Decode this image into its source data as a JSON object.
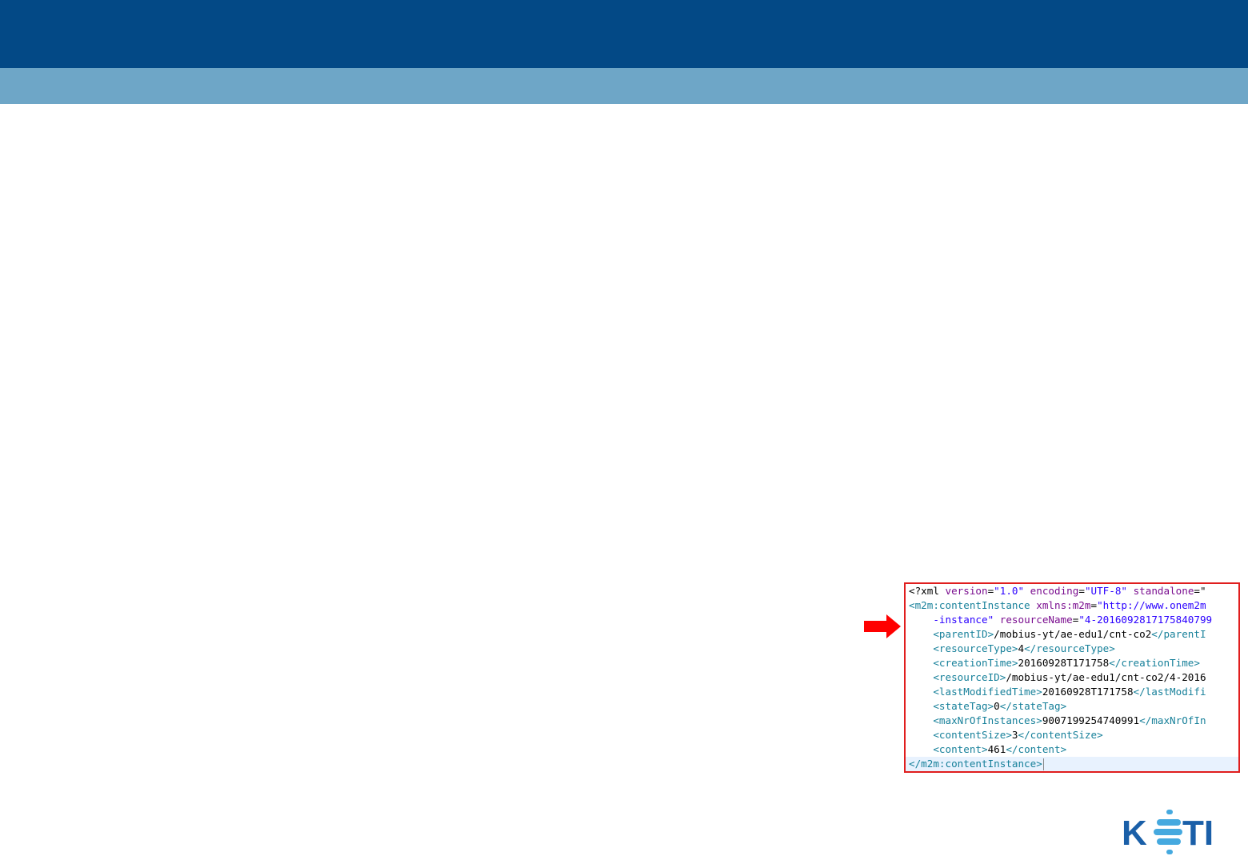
{
  "colors": {
    "header_dark": "#034986",
    "header_light": "#6ea6c7",
    "highlight_border": "#e01e1e",
    "arrow": "#ff0000",
    "logo_blue": "#1a5fa8",
    "logo_dots": "#45a9df"
  },
  "arrow_icon": "red-right-arrow",
  "xml": {
    "lines": [
      {
        "parts": [
          {
            "c": "c-txt",
            "t": "<?xml "
          },
          {
            "c": "c-attr",
            "t": "version"
          },
          {
            "c": "c-txt",
            "t": "="
          },
          {
            "c": "c-str",
            "t": "\"1.0\""
          },
          {
            "c": "c-attr",
            "t": " encoding"
          },
          {
            "c": "c-txt",
            "t": "="
          },
          {
            "c": "c-str",
            "t": "\"UTF-8\""
          },
          {
            "c": "c-attr",
            "t": " standalone"
          },
          {
            "c": "c-txt",
            "t": "=\""
          }
        ]
      },
      {
        "parts": [
          {
            "c": "c-tag",
            "t": "<m2m:contentInstance "
          },
          {
            "c": "c-attr",
            "t": "xmlns:m2m"
          },
          {
            "c": "c-txt",
            "t": "="
          },
          {
            "c": "c-str",
            "t": "\"http://www.onem2m"
          }
        ]
      },
      {
        "parts": [
          {
            "c": "c-str",
            "t": "    -instance\""
          },
          {
            "c": "c-attr",
            "t": " resourceName"
          },
          {
            "c": "c-txt",
            "t": "="
          },
          {
            "c": "c-str",
            "t": "\"4-2016092817175840799"
          }
        ]
      },
      {
        "parts": [
          {
            "c": "c-tag",
            "t": "    <parentID>"
          },
          {
            "c": "c-txt",
            "t": "/mobius-yt/ae-edu1/cnt-co2"
          },
          {
            "c": "c-tag",
            "t": "</parentI"
          }
        ]
      },
      {
        "parts": [
          {
            "c": "c-tag",
            "t": "    <resourceType>"
          },
          {
            "c": "c-txt",
            "t": "4"
          },
          {
            "c": "c-tag",
            "t": "</resourceType>"
          }
        ]
      },
      {
        "parts": [
          {
            "c": "c-tag",
            "t": "    <creationTime>"
          },
          {
            "c": "c-txt",
            "t": "20160928T171758"
          },
          {
            "c": "c-tag",
            "t": "</creationTime>"
          }
        ]
      },
      {
        "parts": [
          {
            "c": "c-tag",
            "t": "    <resourceID>"
          },
          {
            "c": "c-txt",
            "t": "/mobius-yt/ae-edu1/cnt-co2/4-2016"
          }
        ]
      },
      {
        "parts": [
          {
            "c": "c-tag",
            "t": "    <lastModifiedTime>"
          },
          {
            "c": "c-txt",
            "t": "20160928T171758"
          },
          {
            "c": "c-tag",
            "t": "</lastModifi"
          }
        ]
      },
      {
        "parts": [
          {
            "c": "c-tag",
            "t": "    <stateTag>"
          },
          {
            "c": "c-txt",
            "t": "0"
          },
          {
            "c": "c-tag",
            "t": "</stateTag>"
          }
        ]
      },
      {
        "parts": [
          {
            "c": "c-tag",
            "t": "    <maxNrOfInstances>"
          },
          {
            "c": "c-txt",
            "t": "9007199254740991"
          },
          {
            "c": "c-tag",
            "t": "</maxNrOfIn"
          }
        ]
      },
      {
        "parts": [
          {
            "c": "c-tag",
            "t": "    <contentSize>"
          },
          {
            "c": "c-txt",
            "t": "3"
          },
          {
            "c": "c-tag",
            "t": "</contentSize>"
          }
        ]
      },
      {
        "parts": [
          {
            "c": "c-tag",
            "t": "    <content>"
          },
          {
            "c": "c-txt",
            "t": "461"
          },
          {
            "c": "c-tag",
            "t": "</content>"
          }
        ]
      },
      {
        "parts": [
          {
            "c": "c-tag",
            "t": "</m2m:contentInstance>"
          }
        ]
      }
    ]
  },
  "logo": {
    "text": "KETI"
  }
}
